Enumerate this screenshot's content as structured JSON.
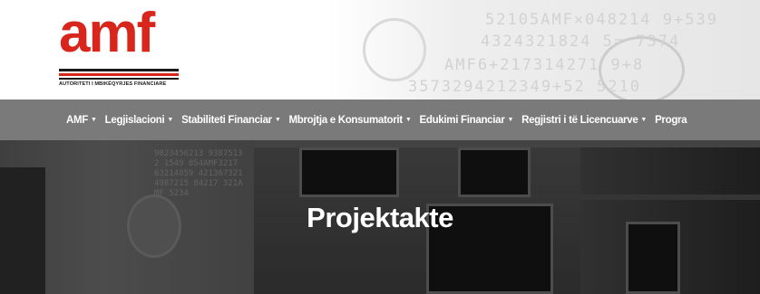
{
  "header": {
    "logo": {
      "wordmark": "amf",
      "tagline": "AUTORITETI I MBIKËQYRJES FINANCIARE"
    },
    "background_numbers": [
      "52105AMF×048214 9+539",
      "4324321824 5=  7374",
      "AMF6+217314271  9+8",
      "3573294212349+52  5210"
    ]
  },
  "nav": {
    "items": [
      {
        "label": "AMF",
        "has_dropdown": true
      },
      {
        "label": "Legjislacioni",
        "has_dropdown": true
      },
      {
        "label": "Stabiliteti Financiar",
        "has_dropdown": true
      },
      {
        "label": "Mbrojtja e Konsumatorit",
        "has_dropdown": true
      },
      {
        "label": "Edukimi Financiar",
        "has_dropdown": true
      },
      {
        "label": "Regjistri i të Licencuarve",
        "has_dropdown": true
      },
      {
        "label": "Progra",
        "has_dropdown": false
      }
    ],
    "caret_glyph": "▼"
  },
  "hero": {
    "title": "Projektakte",
    "decor_numbers": "9823456213 93875132 1549 854AMF3217 63214859 421367321 4987215 84217 321AMF 5234",
    "overlay_text": "AMF"
  },
  "colors": {
    "brand_red": "#d9261c",
    "nav_bg": "#7a7a7a",
    "nav_text": "#ffffff"
  }
}
